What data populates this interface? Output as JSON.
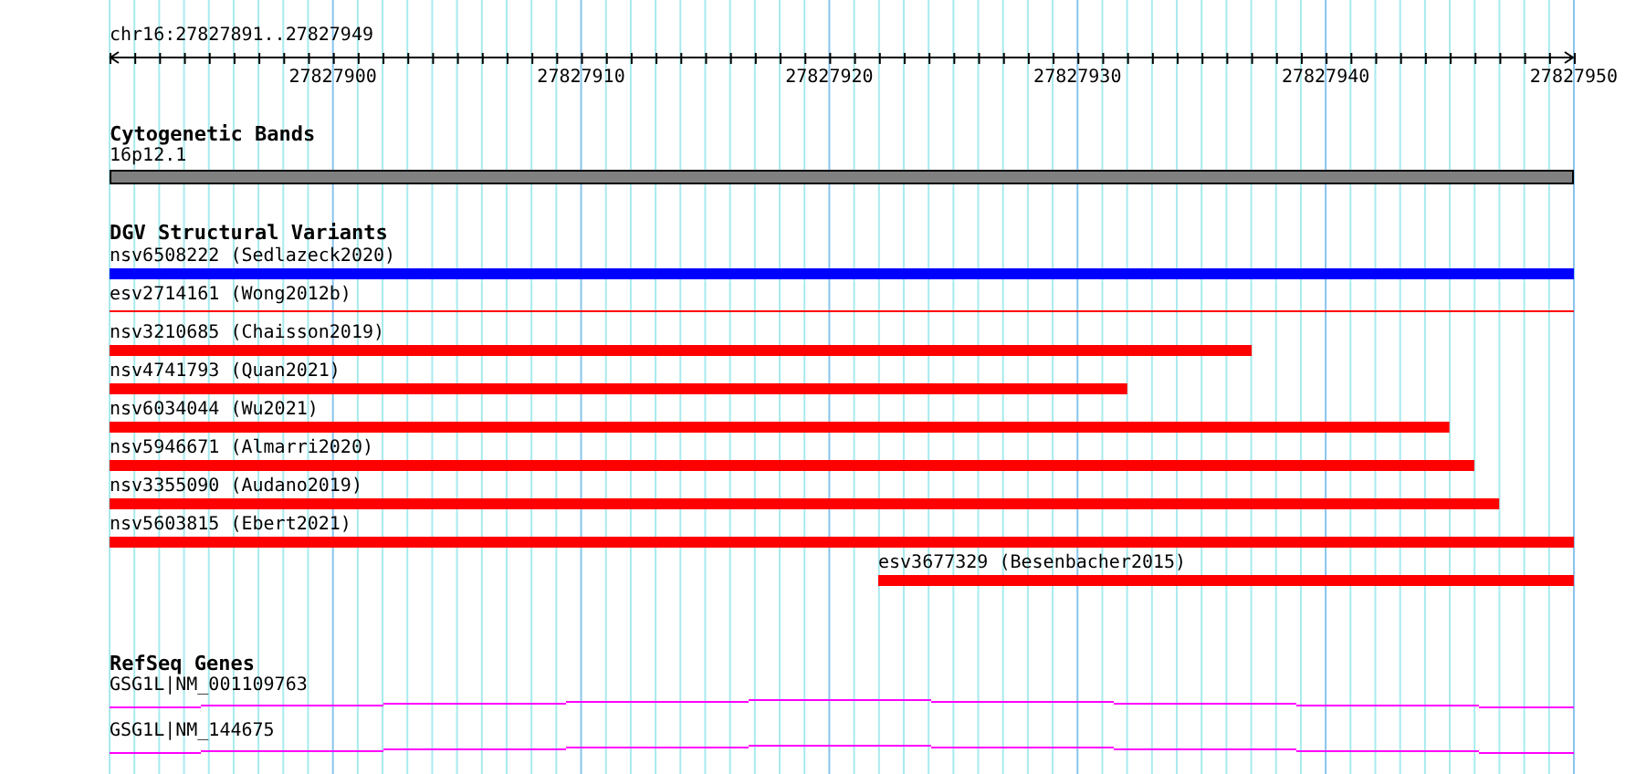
{
  "ruler": {
    "label": "chr16:27827891..27827949",
    "ticks": [
      "27827900",
      "27827910",
      "27827920",
      "27827930",
      "27827940",
      "27827950"
    ]
  },
  "tracks": [
    {
      "title": "Cytogenetic Bands",
      "kind": "bands",
      "features": [
        {
          "label": "16p12.1",
          "kind": "band",
          "level": 1,
          "color": "#808080"
        }
      ]
    },
    {
      "title": "DGV Structural Variants",
      "kind": "variants",
      "features": [
        {
          "label": "nsv6508222 (Sedlazeck2020)",
          "kind": "thick",
          "level": 1,
          "color": "#0000ff"
        },
        {
          "label": "esv2714161 (Wong2012b)",
          "kind": "thin",
          "level": 1,
          "color": "#ff0000"
        },
        {
          "label": "nsv3210685 (Chaisson2019)",
          "kind": "thick",
          "level": 0.78,
          "color": "#ff0000"
        },
        {
          "label": "nsv4741793 (Quan2021)",
          "kind": "thick",
          "level": 0.695,
          "color": "#ff0000"
        },
        {
          "label": "nsv6034044 (Wu2021)",
          "kind": "thick",
          "level": 0.915,
          "color": "#ff0000"
        },
        {
          "label": "nsv5946671 (Almarri2020)",
          "kind": "thick",
          "level": 0.932,
          "color": "#ff0000"
        },
        {
          "label": "nsv3355090 (Audano2019)",
          "kind": "thick",
          "level": 0.949,
          "color": "#ff0000"
        },
        {
          "label": "nsv5603815 (Ebert2021)",
          "kind": "thick",
          "level": 1,
          "color": "#ff0000"
        },
        {
          "label": "esv3677329 (Besenbacher2015)",
          "kind": "trailing",
          "level": 0.475,
          "color": "#ff0000"
        }
      ]
    },
    {
      "title": "RefSeq Genes",
      "kind": "genes",
      "features": [
        {
          "label": "GSG1L|NM_001109763",
          "kind": "intron",
          "color": "#ff00ff"
        },
        {
          "label": "GSG1L|NM_144675",
          "kind": "intron",
          "color": "#ff00ff"
        }
      ]
    }
  ]
}
